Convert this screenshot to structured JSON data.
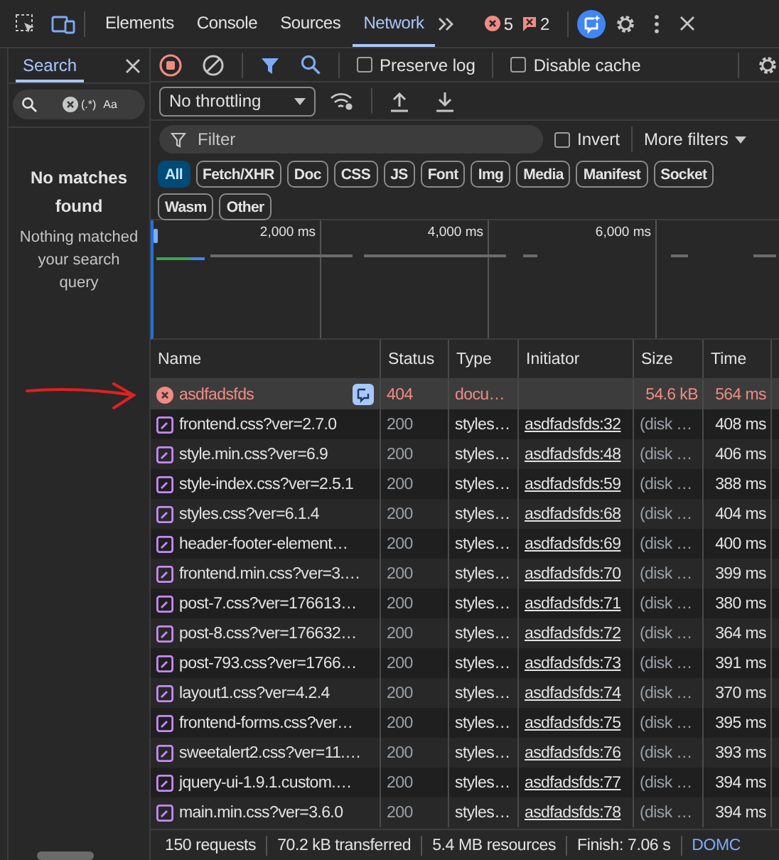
{
  "tab_bar": {
    "tabs": [
      {
        "label": "Elements",
        "selected": false
      },
      {
        "label": "Console",
        "selected": false
      },
      {
        "label": "Sources",
        "selected": false
      },
      {
        "label": "Network",
        "selected": true
      }
    ],
    "error_count": "5",
    "issue_count": "2"
  },
  "search_panel": {
    "tab": "Search",
    "regex_toggle": "(.*)",
    "case_toggle": "Aa",
    "empty_title": "No matches found",
    "empty_text": "Nothing matched your search query"
  },
  "toolbar": {
    "recording": true,
    "preserve_log": {
      "label": "Preserve log",
      "checked": false
    },
    "disable_cache": {
      "label": "Disable cache",
      "checked": false
    },
    "throttling": "No throttling"
  },
  "filter": {
    "placeholder": "Filter",
    "invert": {
      "label": "Invert",
      "checked": false
    },
    "more_filters": "More filters"
  },
  "type_filters": [
    {
      "label": "All",
      "selected": true
    },
    {
      "label": "Fetch/XHR",
      "selected": false
    },
    {
      "label": "Doc",
      "selected": false
    },
    {
      "label": "CSS",
      "selected": false
    },
    {
      "label": "JS",
      "selected": false
    },
    {
      "label": "Font",
      "selected": false
    },
    {
      "label": "Img",
      "selected": false
    },
    {
      "label": "Media",
      "selected": false
    },
    {
      "label": "Manifest",
      "selected": false
    },
    {
      "label": "Socket",
      "selected": false
    },
    {
      "label": "Wasm",
      "selected": false
    },
    {
      "label": "Other",
      "selected": false
    }
  ],
  "overview": {
    "ticks": [
      "2,000 ms",
      "4,000 ms",
      "6,000 ms"
    ]
  },
  "table": {
    "columns": [
      "Name",
      "Status",
      "Type",
      "Initiator",
      "Size",
      "Time"
    ],
    "rows": [
      {
        "kind": "error",
        "selected": true,
        "name": "asdfadsfds",
        "status": "404",
        "type": "docu…",
        "initiator": "",
        "size": "54.6 kB",
        "time": "564 ms"
      },
      {
        "kind": "stylesheet",
        "selected": false,
        "name": "frontend.css?ver=2.7.0",
        "status": "200",
        "type": "styles…",
        "initiator": "asdfadsfds:32",
        "size": "(disk …",
        "time": "408 ms"
      },
      {
        "kind": "stylesheet",
        "selected": false,
        "name": "style.min.css?ver=6.9",
        "status": "200",
        "type": "styles…",
        "initiator": "asdfadsfds:48",
        "size": "(disk …",
        "time": "406 ms"
      },
      {
        "kind": "stylesheet",
        "selected": false,
        "name": "style-index.css?ver=2.5.1",
        "status": "200",
        "type": "styles…",
        "initiator": "asdfadsfds:59",
        "size": "(disk …",
        "time": "388 ms"
      },
      {
        "kind": "stylesheet",
        "selected": false,
        "name": "styles.css?ver=6.1.4",
        "status": "200",
        "type": "styles…",
        "initiator": "asdfadsfds:68",
        "size": "(disk …",
        "time": "404 ms"
      },
      {
        "kind": "stylesheet",
        "selected": false,
        "name": "header-footer-element…",
        "status": "200",
        "type": "styles…",
        "initiator": "asdfadsfds:69",
        "size": "(disk …",
        "time": "400 ms"
      },
      {
        "kind": "stylesheet",
        "selected": false,
        "name": "frontend.min.css?ver=3.…",
        "status": "200",
        "type": "styles…",
        "initiator": "asdfadsfds:70",
        "size": "(disk …",
        "time": "399 ms"
      },
      {
        "kind": "stylesheet",
        "selected": false,
        "name": "post-7.css?ver=176613…",
        "status": "200",
        "type": "styles…",
        "initiator": "asdfadsfds:71",
        "size": "(disk …",
        "time": "380 ms"
      },
      {
        "kind": "stylesheet",
        "selected": false,
        "name": "post-8.css?ver=176632…",
        "status": "200",
        "type": "styles…",
        "initiator": "asdfadsfds:72",
        "size": "(disk …",
        "time": "364 ms"
      },
      {
        "kind": "stylesheet",
        "selected": false,
        "name": "post-793.css?ver=1766…",
        "status": "200",
        "type": "styles…",
        "initiator": "asdfadsfds:73",
        "size": "(disk …",
        "time": "391 ms"
      },
      {
        "kind": "stylesheet",
        "selected": false,
        "name": "layout1.css?ver=4.2.4",
        "status": "200",
        "type": "styles…",
        "initiator": "asdfadsfds:74",
        "size": "(disk …",
        "time": "370 ms"
      },
      {
        "kind": "stylesheet",
        "selected": false,
        "name": "frontend-forms.css?ver…",
        "status": "200",
        "type": "styles…",
        "initiator": "asdfadsfds:75",
        "size": "(disk …",
        "time": "395 ms"
      },
      {
        "kind": "stylesheet",
        "selected": false,
        "name": "sweetalert2.css?ver=11.…",
        "status": "200",
        "type": "styles…",
        "initiator": "asdfadsfds:76",
        "size": "(disk …",
        "time": "393 ms"
      },
      {
        "kind": "stylesheet",
        "selected": false,
        "name": "jquery-ui-1.9.1.custom.…",
        "status": "200",
        "type": "styles…",
        "initiator": "asdfadsfds:77",
        "size": "(disk …",
        "time": "394 ms"
      },
      {
        "kind": "stylesheet",
        "selected": false,
        "name": "main.min.css?ver=3.6.0",
        "status": "200",
        "type": "styles…",
        "initiator": "asdfadsfds:78",
        "size": "(disk …",
        "time": "394 ms"
      }
    ]
  },
  "status_bar": [
    "150 requests",
    "70.2 kB transferred",
    "5.4 MB resources",
    "Finish: 7.06 s",
    "DOMC"
  ]
}
